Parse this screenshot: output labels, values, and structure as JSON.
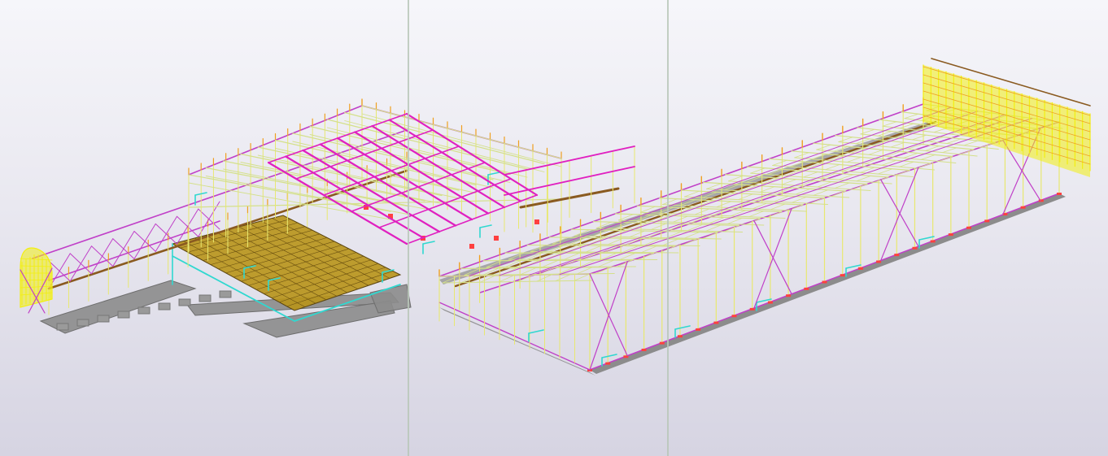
{
  "viewport": {
    "kind": "3d-model-view",
    "background_top": "#f6f6fa",
    "background_bottom": "#d6d4e2"
  },
  "structure_colors": {
    "bracing": "#c040c8",
    "magenta_beam": "#e020c0",
    "truss": "#d4e08a",
    "column": "#e8e870",
    "cyan_member": "#30d8d0",
    "foundation": "#8c8c8c",
    "deck_plate": "#b89418",
    "yellow_cladding": "#f2ef10",
    "brown_beam": "#8a5a20",
    "orange_mark": "#f0a020",
    "red_mark": "#ff4040"
  },
  "view_dividers": 2
}
